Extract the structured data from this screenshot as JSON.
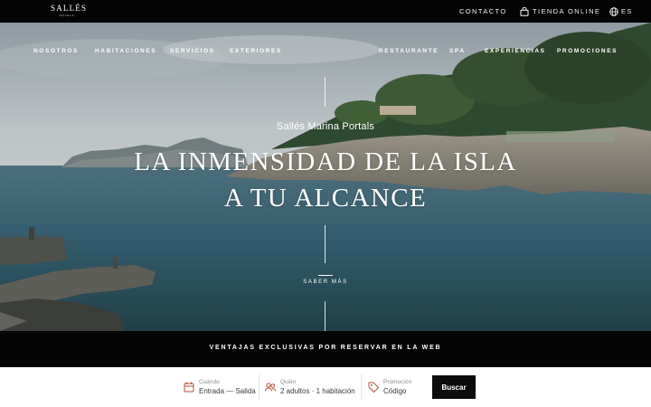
{
  "topbar": {
    "logo_text": "SALLÉS",
    "logo_sub": "HOTELS",
    "contact": "CONTACTO",
    "shop": "TIENDA ONLINE",
    "lang": "ES"
  },
  "nav": {
    "left": [
      "NOSOTROS",
      "HABITACIONES",
      "SERVICIOS",
      "EXTERIORES"
    ],
    "right": [
      "RESTAURANTE",
      "SPA",
      "EXPERIENCIAS",
      "PROMOCIONES"
    ]
  },
  "hero": {
    "hotel_name": "Sallés Marina Portals",
    "headline_1": "LA INMENSIDAD DE LA ISLA",
    "headline_2": "A TU ALCANCE",
    "more": "SABER MÁS"
  },
  "strip": {
    "text": "VENTAJAS EXCLUSIVAS POR RESERVAR EN LA WEB"
  },
  "booking": {
    "when_label": "Cuándo",
    "when_value": "Entrada — Salida",
    "who_label": "Quién",
    "who_value": "2 adultos · 1 habitación",
    "promo_label": "Promoción",
    "promo_value": "Código",
    "search": "Buscar"
  },
  "colors": {
    "accent": "#b5513a",
    "dark": "#050505"
  },
  "icons": [
    "bag-icon",
    "globe-icon",
    "calendar-icon",
    "people-icon",
    "tag-icon"
  ]
}
